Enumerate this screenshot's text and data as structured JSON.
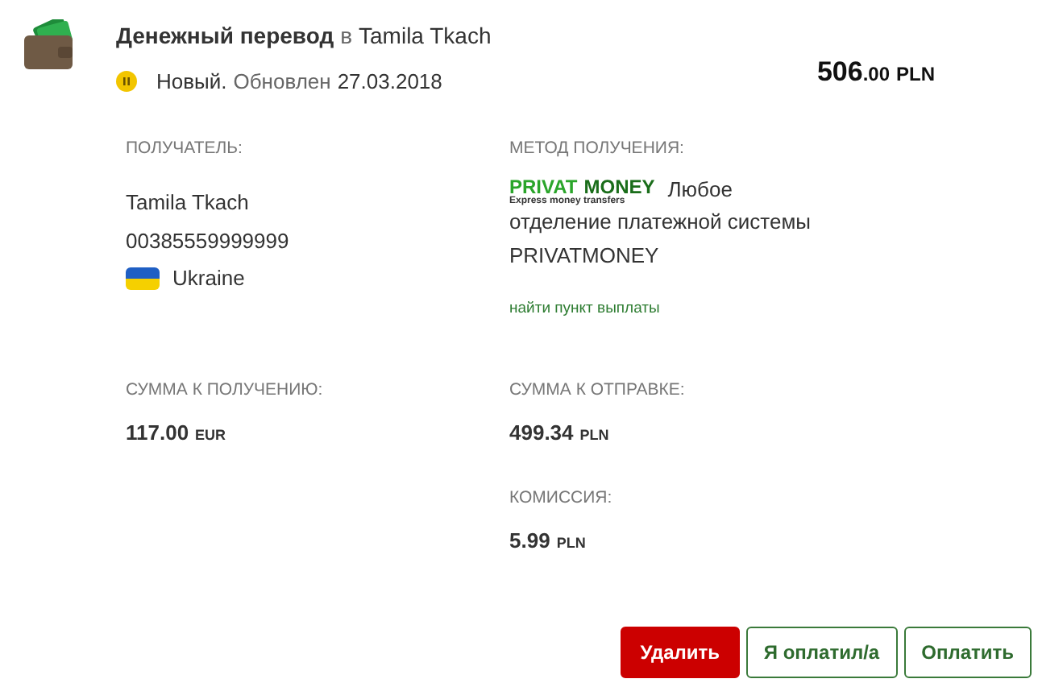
{
  "header": {
    "title_type": "Денежный перевод",
    "title_prep": "в",
    "title_recipient": "Tamila Tkach",
    "status": "Новый.",
    "updated_label": "Обновлен",
    "updated_date": "27.03.2018",
    "amount": {
      "whole": "506",
      "fraction": ".00",
      "currency": "PLN"
    }
  },
  "recipient": {
    "label": "ПОЛУЧАТЕЛЬ:",
    "name": "Tamila Tkach",
    "phone": "00385559999999",
    "country": "Ukraine"
  },
  "method": {
    "label": "МЕТОД ПОЛУЧЕНИЯ:",
    "logo": {
      "word_1": "PRIVAT",
      "word_2": "MONEY",
      "tagline": "Express money transfers"
    },
    "description_first": "Любое",
    "description_rest": "отделение платежной системы PRIVATMONEY",
    "link": "найти пункт выплаты"
  },
  "amounts_left": [
    {
      "label": "СУММА К ПОЛУЧЕНИЮ:",
      "whole": "117.00",
      "currency": "EUR"
    }
  ],
  "amounts_right": [
    {
      "label": "СУММА К ОТПРАВКЕ:",
      "whole": "499.34",
      "currency": "PLN"
    },
    {
      "label": "КОМИССИЯ:",
      "whole": "5.99",
      "currency": "PLN"
    }
  ],
  "buttons": [
    {
      "label": "Удалить",
      "kind": "danger"
    },
    {
      "label": "Я оплатил/а",
      "kind": "outline"
    },
    {
      "label": "Оплатить",
      "kind": "outline"
    }
  ]
}
